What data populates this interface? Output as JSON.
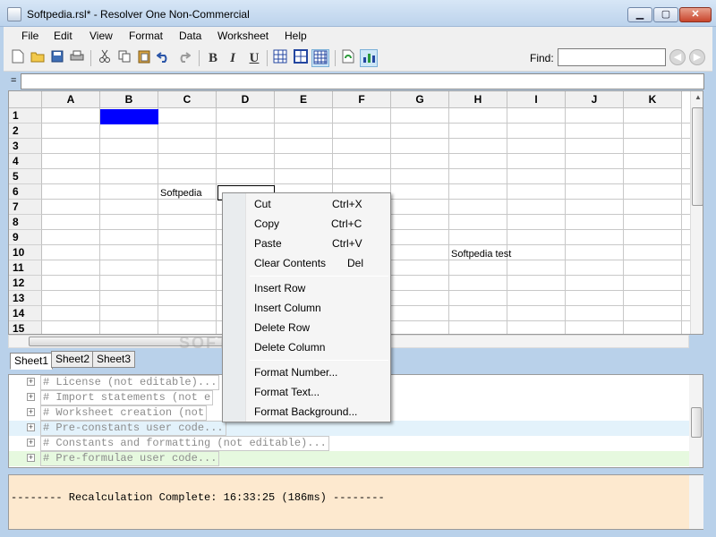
{
  "window": {
    "title": "Softpedia.rsl* - Resolver One Non-Commercial",
    "minimize": "▁",
    "maximize": "▢",
    "close": "✕"
  },
  "menu": [
    "File",
    "Edit",
    "View",
    "Format",
    "Data",
    "Worksheet",
    "Help"
  ],
  "toolbar": {
    "bold": "B",
    "italic": "I",
    "underline": "U",
    "find_label": "Find:",
    "find_value": "",
    "back_icon": "◀",
    "forward_icon": "▶"
  },
  "formula_bar": {
    "label": "=",
    "value": ""
  },
  "grid": {
    "columns": [
      "A",
      "B",
      "C",
      "D",
      "E",
      "F",
      "G",
      "H",
      "I",
      "J",
      "K"
    ],
    "rows": [
      "1",
      "2",
      "3",
      "4",
      "5",
      "6",
      "7",
      "8",
      "9",
      "10",
      "11",
      "12",
      "13",
      "14",
      "15"
    ],
    "cells": {
      "C6": "Softpedia",
      "H10": "Softpedia test"
    },
    "selected_fill_color": "#0000ff"
  },
  "sheets": [
    "Sheet1",
    "Sheet2",
    "Sheet3"
  ],
  "active_sheet": "Sheet1",
  "code_sections": [
    "# License (not editable)...",
    "# Import statements (not e",
    "# Worksheet creation (not",
    "# Pre-constants user code...",
    "# Constants and formatting (not editable)...",
    "# Pre-formulae user code..."
  ],
  "output": "-------- Recalculation Complete: 16:33:25 (186ms) --------",
  "context_menu": [
    {
      "label": "Cut",
      "shortcut": "Ctrl+X"
    },
    {
      "label": "Copy",
      "shortcut": "Ctrl+C"
    },
    {
      "label": "Paste",
      "shortcut": "Ctrl+V"
    },
    {
      "label": "Clear Contents",
      "shortcut": "Del"
    },
    {
      "label": "Insert Row"
    },
    {
      "label": "Insert Column"
    },
    {
      "label": "Delete Row"
    },
    {
      "label": "Delete Column"
    },
    {
      "label": "Format Number..."
    },
    {
      "label": "Format Text..."
    },
    {
      "label": "Format Background..."
    }
  ],
  "watermark": "SOFTPEDIA"
}
